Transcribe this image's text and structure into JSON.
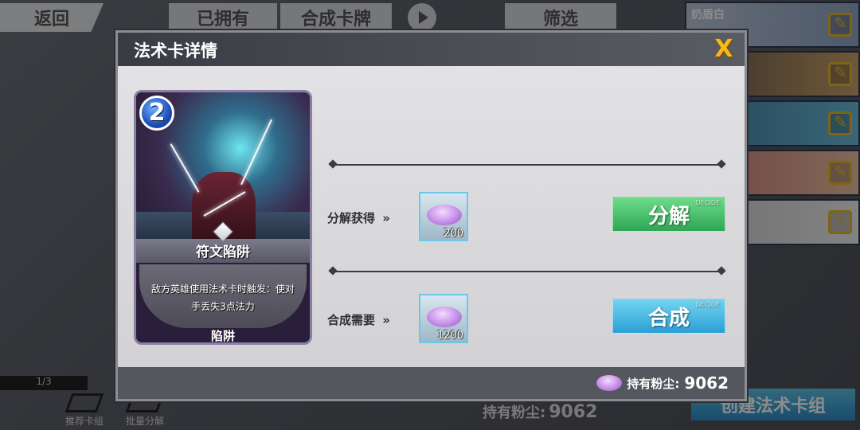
{
  "background": {
    "back_label": "返回",
    "tabs": [
      "已拥有",
      "合成卡牌",
      "筛选"
    ],
    "deck_list": [
      {
        "name": "奶盾白"
      },
      {
        "name": ""
      },
      {
        "name": ""
      },
      {
        "name": ""
      },
      {
        "name": ""
      }
    ],
    "page_counter": "1/3",
    "bottom_buttons": [
      "推荐卡组",
      "批量分解"
    ],
    "dust_label": "持有粉尘:",
    "dust_value": "9062",
    "create_deck_label": "创建法术卡组"
  },
  "modal": {
    "title": "法术卡详情",
    "close_label": "X",
    "card": {
      "cost": "2",
      "name": "符文陷阱",
      "description": "敌方英雄使用法术卡时触发：使对手丢失3点法力",
      "type": "陷阱"
    },
    "decompose": {
      "label": "分解获得",
      "arrows": "»",
      "amount": "200",
      "button_label": "分解",
      "button_tag": "DECIDE"
    },
    "compose": {
      "label": "合成需要",
      "arrows": "»",
      "amount": "1200",
      "button_label": "合成",
      "button_tag": "DECIDE"
    },
    "footer": {
      "dust_label": "持有粉尘:",
      "dust_value": "9062"
    }
  }
}
